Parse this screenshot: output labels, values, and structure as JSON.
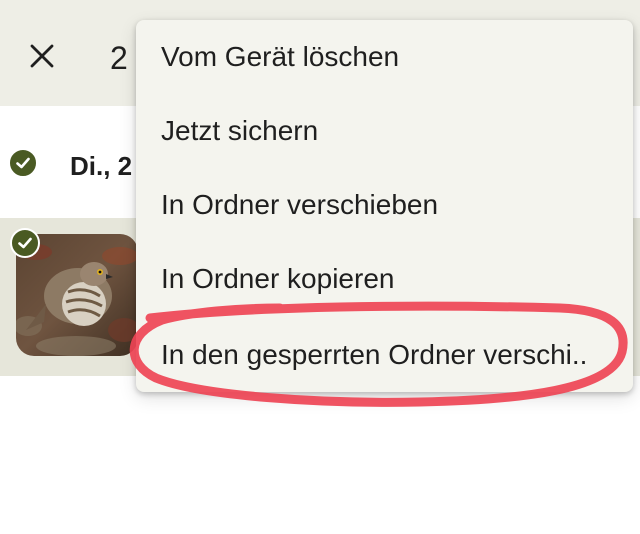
{
  "header": {
    "close_icon": "close-icon",
    "selection_count": "2"
  },
  "date_group": {
    "label": "Di., 2",
    "check_icon": "check-circle-icon"
  },
  "photo": {
    "description_icon": "photo-thumbnail",
    "selected": true
  },
  "menu": {
    "items": [
      {
        "label": "Vom Gerät löschen"
      },
      {
        "label": "Jetzt sichern"
      },
      {
        "label": "In Ordner verschieben"
      },
      {
        "label": "In Ordner kopieren"
      },
      {
        "label": "In den gesperrten Ordner verschi.."
      }
    ]
  },
  "colors": {
    "topbar": "#eeeee6",
    "check_green": "#4a5a23",
    "menu_bg": "#f4f4ee",
    "annotation_red": "#ee4455"
  }
}
